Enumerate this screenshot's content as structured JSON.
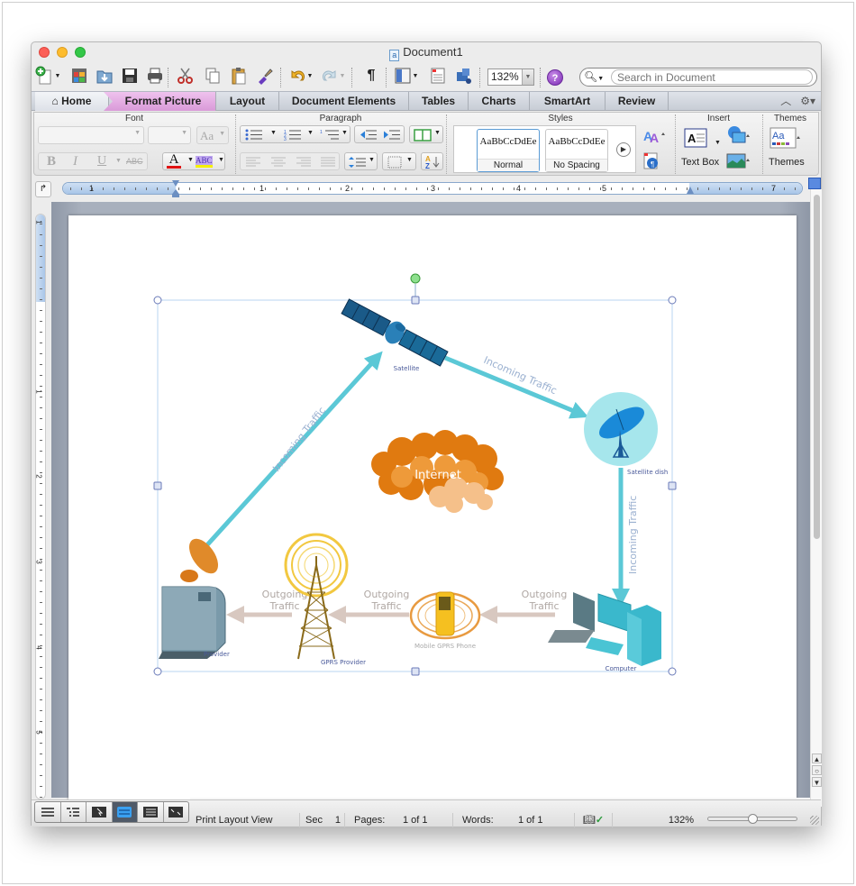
{
  "window": {
    "title": "Document1"
  },
  "toolbar": {
    "zoom_value": "132%",
    "search_placeholder": "Search in Document",
    "help_label": "?"
  },
  "ribbon_tabs": [
    {
      "label": "Home",
      "active": false
    },
    {
      "label": "Format Picture",
      "active": true
    },
    {
      "label": "Layout"
    },
    {
      "label": "Document Elements"
    },
    {
      "label": "Tables"
    },
    {
      "label": "Charts"
    },
    {
      "label": "SmartArt"
    },
    {
      "label": "Review"
    }
  ],
  "ribbon": {
    "groups": {
      "font": "Font",
      "paragraph": "Paragraph",
      "styles": "Styles",
      "insert": "Insert",
      "themes": "Themes"
    },
    "font_buttons": {
      "bold": "B",
      "italic": "I",
      "underline": "U",
      "strike": "ABC",
      "case": "Aa",
      "font_color": "A",
      "highlight": "ABC"
    },
    "styles": [
      {
        "sample": "AaBbCcDdEe",
        "name": "Normal",
        "selected": true
      },
      {
        "sample": "AaBbCcDdEe",
        "name": "No Spacing",
        "selected": false
      }
    ],
    "insert": {
      "text_box": "Text Box"
    },
    "themes": {
      "label": "Themes",
      "sample": "Aa"
    },
    "pilcrow": "¶"
  },
  "ruler": {
    "h_labels": [
      "1",
      "1",
      "2",
      "3",
      "4",
      "5",
      "7"
    ],
    "v_labels": [
      "1",
      "1",
      "2",
      "3",
      "4",
      "5"
    ]
  },
  "diagram": {
    "nodes": {
      "satellite": "Satellite",
      "satellite_dish": "Satellite dish",
      "internet": "Internet",
      "provider": "Provider",
      "gprs_provider": "GPRS Provider",
      "mobile_phone": "Mobile GPRS Phone",
      "computer": "Computer"
    },
    "edges": {
      "provider_to_satellite": "Incoming Traffic",
      "satellite_to_dish": "Incoming Traffic",
      "dish_to_computer": "Incoming Traffic",
      "computer_to_phone_1": "Outgoing",
      "computer_to_phone_2": "Traffic",
      "phone_to_tower_1": "Outgoing",
      "phone_to_tower_2": "Traffic",
      "tower_to_provider_1": "Outgoing",
      "tower_to_provider_2": "Traffic"
    },
    "colors": {
      "incoming": "#5bc8d6",
      "outgoing": "#d8c8c0",
      "label_blue": "#4a5a9a",
      "internet": "#e07a10"
    }
  },
  "statusbar": {
    "view": "Print Layout View",
    "sec_label": "Sec",
    "sec_value": "1",
    "pages_label": "Pages:",
    "pages_value": "1 of 1",
    "words_label": "Words:",
    "words_value": "1 of 1",
    "zoom": "132%",
    "zoom_slider_fraction": 0.5
  }
}
